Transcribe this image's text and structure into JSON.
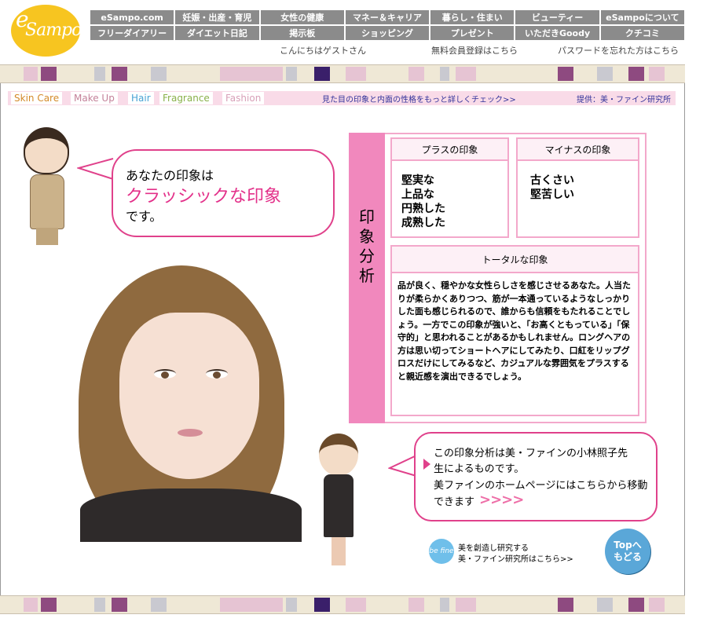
{
  "logo": {
    "text": "Sampo",
    "prefix": "e"
  },
  "nav": {
    "row1": [
      "eSampo.com",
      "妊娠・出産・育児",
      "女性の健康",
      "マネー＆キャリア",
      "暮らし・住まい",
      "ビューティー",
      "eSampoについて"
    ],
    "row2": [
      "フリーダイアリー",
      "ダイエット日記",
      "掲示板",
      "ショッピング",
      "プレゼント",
      "いただきGoody",
      "クチコミ"
    ]
  },
  "subnav": {
    "greeting": "こんにちはゲストさん",
    "register": "無料会員登録はこちら",
    "password": "パスワードを忘れた方はこちら"
  },
  "categories": [
    {
      "label": "Skin Care",
      "color": "#d48a2a"
    },
    {
      "label": "Make Up",
      "color": "#c4829a"
    },
    {
      "label": "Hair",
      "color": "#4aa3d4"
    },
    {
      "label": "Fragrance",
      "color": "#8ab04a"
    },
    {
      "label": "Fashion",
      "color": "#d8a0b8"
    }
  ],
  "catbar": {
    "check_link": "見た目の印象と内面の性格をもっと詳しくチェック>>",
    "credit": "提供：美・ファイン研究所"
  },
  "bubble1": {
    "line1": "あなたの印象は",
    "highlight": "クラッシックな印象",
    "line3": "です。"
  },
  "analysis": {
    "title": [
      "印",
      "象",
      "分",
      "析"
    ],
    "plus_title": "プラスの印象",
    "plus_items": [
      "堅実な",
      "上品な",
      "円熟した",
      "成熟した"
    ],
    "minus_title": "マイナスの印象",
    "minus_items": [
      "古くさい",
      "堅苦しい"
    ],
    "total_title": "トータルな印象",
    "total_text": "品が良く、穏やかな女性らしさを感じさせるあなた。人当たりが柔らかくありつつ、筋が一本通っているようなしっかりした面も感じられるので、誰からも信頼をもたれることでしょう。一方でこの印象が強いと、「お高くともっている」「保守的」と思われることがあるかもしれません。ロングヘアの方は思い切ってショートヘアにしてみたり、口紅をリップグロスだけにしてみるなど、カジュアルな雰囲気をプラスすると親近感を演出できるでしょう。"
  },
  "bubble2": {
    "lines": [
      "この印象分析は美・ファインの小林照子先",
      "生によるものです。",
      "美ファインのホームページにはこちらから移動",
      "できます"
    ],
    "arrows": ">>>>"
  },
  "footer": {
    "bfine_icon": "be fine",
    "bfine_line1": "美を創造し研究する",
    "bfine_line2": "美・ファイン研究所はこちら>>",
    "top_button": [
      "Topへ",
      "もどる"
    ]
  },
  "colors": {
    "accent_pink": "#e0418b",
    "panel_pink": "#f188bd",
    "nav_gray": "#8b8b8b",
    "logo_yellow": "#f7c520"
  }
}
